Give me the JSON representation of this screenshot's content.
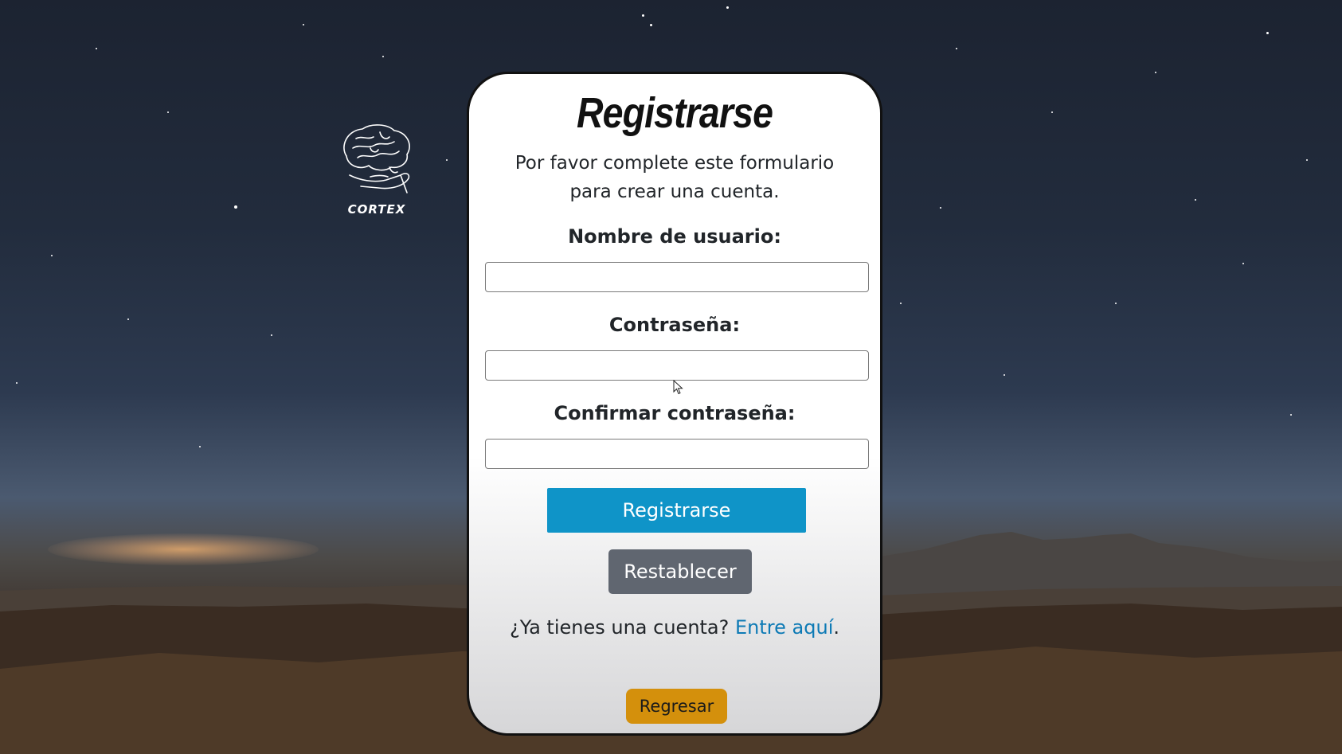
{
  "logo": {
    "text": "CORTEX",
    "icon": "brain-in-hand-icon"
  },
  "form": {
    "title": "Registrarse",
    "subtitle_line1": "Por favor complete este formulario",
    "subtitle_line2": "para crear una cuenta.",
    "username": {
      "label": "Nombre de usuario:",
      "value": "",
      "placeholder": ""
    },
    "password": {
      "label": "Contraseña:",
      "value": "",
      "placeholder": ""
    },
    "confirm_password": {
      "label": "Confirmar contraseña:",
      "value": "",
      "placeholder": ""
    },
    "submit_label": "Registrarse",
    "reset_label": "Restablecer",
    "login_prompt": "¿Ya tienes una cuenta? ",
    "login_link": "Entre aquí",
    "login_suffix": ".",
    "back_label": "Regresar"
  },
  "colors": {
    "primary_button": "#0f94c8",
    "secondary_button": "#606670",
    "back_button": "#d4900c",
    "link": "#0d7ab5"
  }
}
